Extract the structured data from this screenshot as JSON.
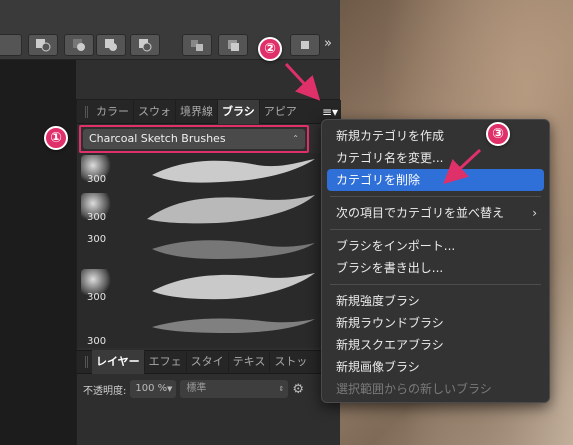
{
  "panel_tabs": [
    "カラー",
    "スウォ",
    "境界線",
    "ブラシ",
    "アピア"
  ],
  "category": {
    "selected": "Charcoal Sketch Brushes"
  },
  "brushes": [
    {
      "size": "300"
    },
    {
      "size": "300"
    },
    {
      "size": "300"
    },
    {
      "size": "300"
    },
    {
      "size": "300"
    }
  ],
  "layers_tabs": [
    "レイヤー",
    "エフェ",
    "スタイ",
    "テキス",
    "ストッ"
  ],
  "layers": {
    "opacity_label": "不透明度:",
    "opacity_value": "100 %",
    "blend_mode": "標準"
  },
  "menu": {
    "items": [
      {
        "label": "新規カテゴリを作成"
      },
      {
        "label": "カテゴリ名を変更..."
      },
      {
        "label": "カテゴリを削除",
        "selected": true
      },
      {
        "label": "次の項目でカテゴリを並べ替え",
        "submenu": true
      },
      {
        "label": "ブラシをインポート..."
      },
      {
        "label": "ブラシを書き出し..."
      },
      {
        "label": "新規強度ブラシ"
      },
      {
        "label": "新規ラウンドブラシ"
      },
      {
        "label": "新規スクエアブラシ"
      },
      {
        "label": "新規画像ブラシ"
      },
      {
        "label": "選択範囲からの新しいブラシ",
        "disabled": true
      }
    ]
  },
  "annotations": [
    "①",
    "②",
    "③"
  ],
  "colors": {
    "accent": "#e0306a",
    "selection": "#2f6fd8"
  }
}
